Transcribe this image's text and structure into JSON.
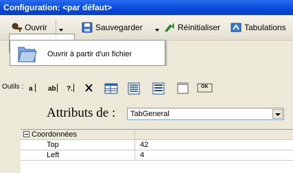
{
  "window": {
    "title": "Configuration: <par défaut>"
  },
  "toolbar": {
    "open_label": "Ouvrir",
    "save_label": "Sauvegarder",
    "reset_label": "Réinitialiser",
    "tabs_label": "Tabulations"
  },
  "menu": {
    "open_file_label": "Ouvrir à partir d'un fichier"
  },
  "tools": {
    "label": "Outils :",
    "icons": [
      "label-tool-icon",
      "textbox-tool-icon",
      "numeric-tool-icon",
      "delete-tool-icon",
      "table-tool-icon",
      "list-tool-icon",
      "list2-tool-icon",
      "panel-tool-icon",
      "ok-button-tool-icon"
    ],
    "ok_text": "OK"
  },
  "attributes": {
    "label": "Attributs de :",
    "selected": "TabGeneral"
  },
  "properties": {
    "group": "Coordonnées",
    "rows": [
      {
        "name": "Top",
        "value": "42"
      },
      {
        "name": "Left",
        "value": "4"
      }
    ]
  }
}
